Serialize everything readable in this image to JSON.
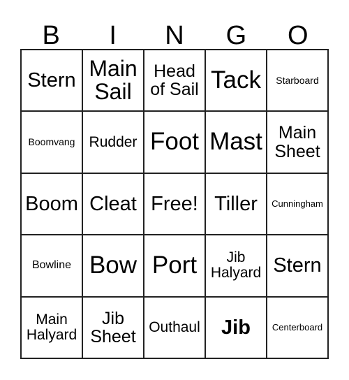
{
  "card": {
    "title": "BINGO",
    "header_letters": [
      "B",
      "I",
      "N",
      "G",
      "O"
    ],
    "free_space_label": "Free!",
    "rows": [
      [
        {
          "label": "Stern",
          "size": "fs-lg",
          "bold": false
        },
        {
          "label": "Main\nSail",
          "size": "fs-xl",
          "bold": false
        },
        {
          "label": "Head\nof Sail",
          "size": "fs-md",
          "bold": false
        },
        {
          "label": "Tack",
          "size": "fs-xxl",
          "bold": false
        },
        {
          "label": "Starboard",
          "size": "fs-xxs",
          "bold": false
        }
      ],
      [
        {
          "label": "Boomvang",
          "size": "fs-xxs",
          "bold": false
        },
        {
          "label": "Rudder",
          "size": "fs-sm",
          "bold": false
        },
        {
          "label": "Foot",
          "size": "fs-xxl",
          "bold": false
        },
        {
          "label": "Mast",
          "size": "fs-xxl",
          "bold": false
        },
        {
          "label": "Main\nSheet",
          "size": "fs-md",
          "bold": false
        }
      ],
      [
        {
          "label": "Boom",
          "size": "fs-lg",
          "bold": false
        },
        {
          "label": "Cleat",
          "size": "fs-lg",
          "bold": false
        },
        {
          "label": "Free!",
          "size": "fs-lg",
          "bold": false
        },
        {
          "label": "Tiller",
          "size": "fs-lg",
          "bold": false
        },
        {
          "label": "Cunningham",
          "size": "fs-tiny",
          "bold": false
        }
      ],
      [
        {
          "label": "Bowline",
          "size": "fs-xs",
          "bold": false
        },
        {
          "label": "Bow",
          "size": "fs-xxl",
          "bold": false
        },
        {
          "label": "Port",
          "size": "fs-xxl",
          "bold": false
        },
        {
          "label": "Jib\nHalyard",
          "size": "fs-sm",
          "bold": false
        },
        {
          "label": "Stern",
          "size": "fs-lg",
          "bold": false
        }
      ],
      [
        {
          "label": "Main\nHalyard",
          "size": "fs-sm",
          "bold": false
        },
        {
          "label": "Jib\nSheet",
          "size": "fs-md",
          "bold": false
        },
        {
          "label": "Outhaul",
          "size": "fs-sm",
          "bold": false
        },
        {
          "label": "Jib",
          "size": "fs-lg",
          "bold": true
        },
        {
          "label": "Centerboard",
          "size": "fs-tiny",
          "bold": false
        }
      ]
    ]
  },
  "colors": {
    "border": "#222222",
    "text": "#000000",
    "background": "#ffffff"
  }
}
